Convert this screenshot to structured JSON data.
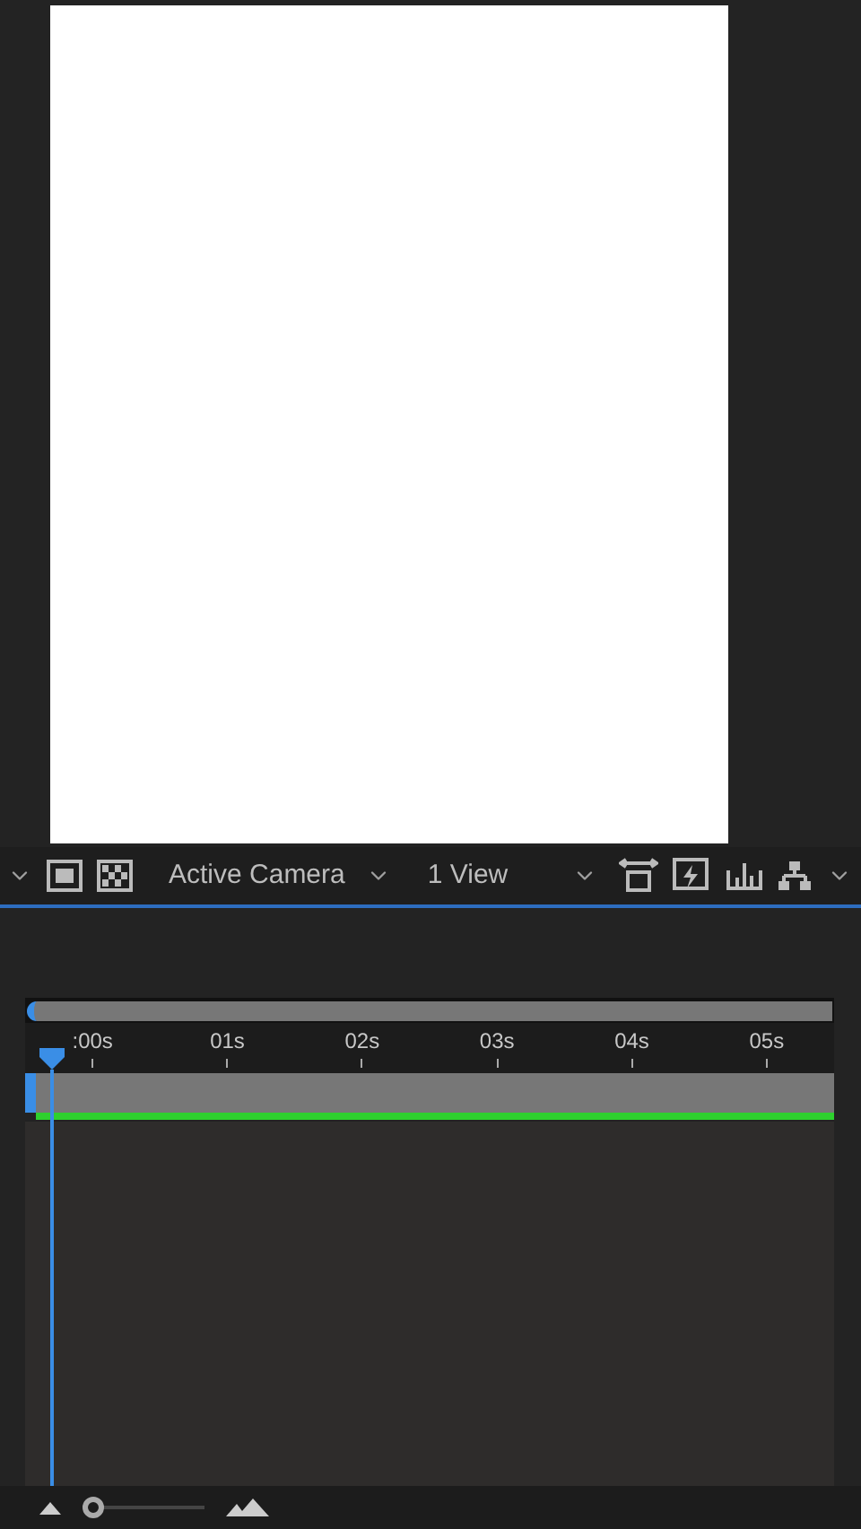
{
  "viewer_toolbar": {
    "camera_menu": {
      "value": "Active Camera"
    },
    "view_menu": {
      "value": "1 View"
    }
  },
  "timeline": {
    "time_labels": [
      ":00s",
      "01s",
      "02s",
      "03s",
      "04s",
      "05s"
    ],
    "zoom_slider": {
      "level": 0.02
    }
  }
}
